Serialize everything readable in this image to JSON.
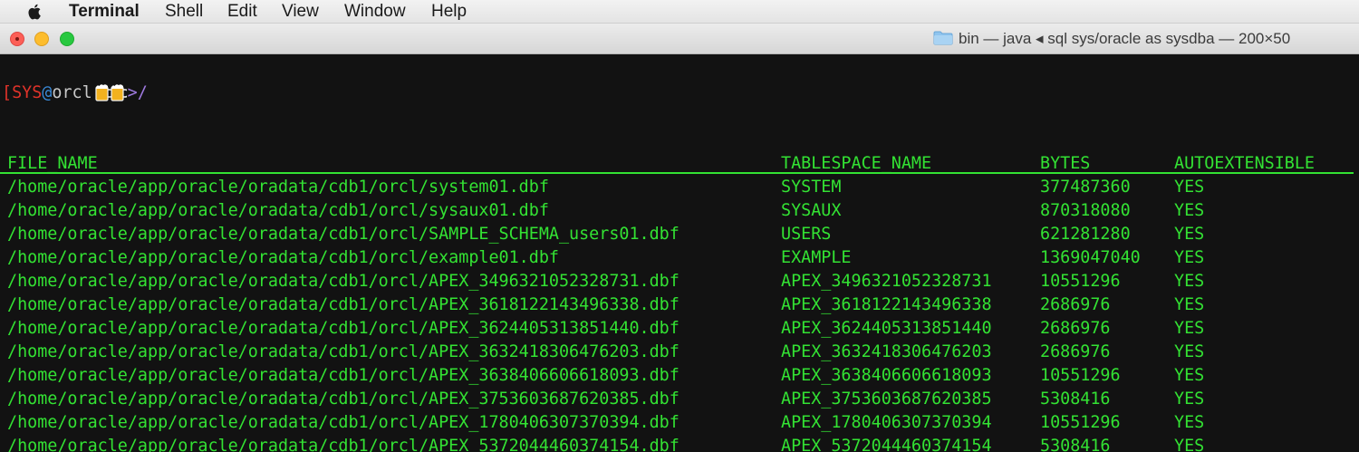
{
  "menubar": {
    "app_name": "Terminal",
    "items": [
      "Shell",
      "Edit",
      "View",
      "Window",
      "Help"
    ]
  },
  "window": {
    "title": "bin — java ◂ sql sys/oracle as sysdba — 200×50"
  },
  "prompt": {
    "open_bracket": "[",
    "user": "SYS",
    "at": "@",
    "host": "orcl",
    "suffix": ">/"
  },
  "table": {
    "headers": [
      "FILE_NAME",
      "TABLESPACE_NAME",
      "BYTES",
      "AUTOEXTENSIBLE"
    ],
    "rows": [
      [
        "/home/oracle/app/oracle/oradata/cdb1/orcl/system01.dbf",
        "SYSTEM",
        "377487360",
        "YES"
      ],
      [
        "/home/oracle/app/oracle/oradata/cdb1/orcl/sysaux01.dbf",
        "SYSAUX",
        "870318080",
        "YES"
      ],
      [
        "/home/oracle/app/oracle/oradata/cdb1/orcl/SAMPLE_SCHEMA_users01.dbf",
        "USERS",
        "621281280",
        "YES"
      ],
      [
        "/home/oracle/app/oracle/oradata/cdb1/orcl/example01.dbf",
        "EXAMPLE",
        "1369047040",
        "YES"
      ],
      [
        "/home/oracle/app/oracle/oradata/cdb1/orcl/APEX_3496321052328731.dbf",
        "APEX_3496321052328731",
        "10551296",
        "YES"
      ],
      [
        "/home/oracle/app/oracle/oradata/cdb1/orcl/APEX_3618122143496338.dbf",
        "APEX_3618122143496338",
        "2686976",
        "YES"
      ],
      [
        "/home/oracle/app/oracle/oradata/cdb1/orcl/APEX_3624405313851440.dbf",
        "APEX_3624405313851440",
        "2686976",
        "YES"
      ],
      [
        "/home/oracle/app/oracle/oradata/cdb1/orcl/APEX_3632418306476203.dbf",
        "APEX_3632418306476203",
        "2686976",
        "YES"
      ],
      [
        "/home/oracle/app/oracle/oradata/cdb1/orcl/APEX_3638406606618093.dbf",
        "APEX_3638406606618093",
        "10551296",
        "YES"
      ],
      [
        "/home/oracle/app/oracle/oradata/cdb1/orcl/APEX_3753603687620385.dbf",
        "APEX_3753603687620385",
        "5308416",
        "YES"
      ],
      [
        "/home/oracle/app/oracle/oradata/cdb1/orcl/APEX_1780406307370394.dbf",
        "APEX_1780406307370394",
        "10551296",
        "YES"
      ],
      [
        "/home/oracle/app/oracle/oradata/cdb1/orcl/APEX_5372044460374154.dbf",
        "APEX_5372044460374154",
        "5308416",
        "YES"
      ]
    ]
  },
  "colors": {
    "terminal_bg": "#121212",
    "output_green": "#33e233",
    "prompt_user": "#e0332a",
    "prompt_at": "#3a8ad9",
    "prompt_symbol": "#9f7ae0"
  },
  "icons": [
    "apple-icon",
    "folder-icon",
    "beer-icon"
  ]
}
